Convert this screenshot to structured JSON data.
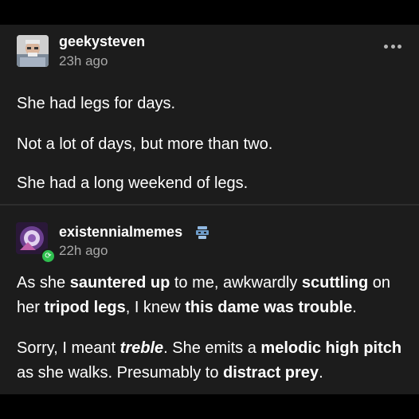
{
  "colors": {
    "background": "#000000",
    "panel": "#1c1c1c",
    "text": "#ffffff",
    "muted": "#a8a8a8",
    "reblog_badge": "#2fbf4f"
  },
  "post1": {
    "avatar_icon": "user-avatar-photo",
    "username": "geekysteven",
    "time": "23h ago",
    "menu_icon": "more-dots-icon",
    "paragraphs": [
      "She had legs for days.",
      "Not a lot of days, but more than two.",
      "She had a long weekend of legs."
    ]
  },
  "post2": {
    "avatar_icon": "user-avatar-art",
    "badge_icon": "reblog-icon",
    "flair_icon": "robot-flair-icon",
    "username": "existennialmemes",
    "time": "22h ago",
    "para1": {
      "s1": "As she ",
      "b1": "sauntered up",
      "s2": " to me, awkwardly ",
      "b2": "scuttling",
      "s3": " on her ",
      "b3": "tripod legs",
      "s4": ", I knew ",
      "b4": "this dame was trouble",
      "s5": "."
    },
    "para2": {
      "s1": "Sorry, I meant ",
      "bi": "treble",
      "s2": ". She emits a ",
      "b1": "melodic high pitch",
      "s3": " as she walks. Presumably to ",
      "b2": "distract prey",
      "s4": "."
    }
  }
}
